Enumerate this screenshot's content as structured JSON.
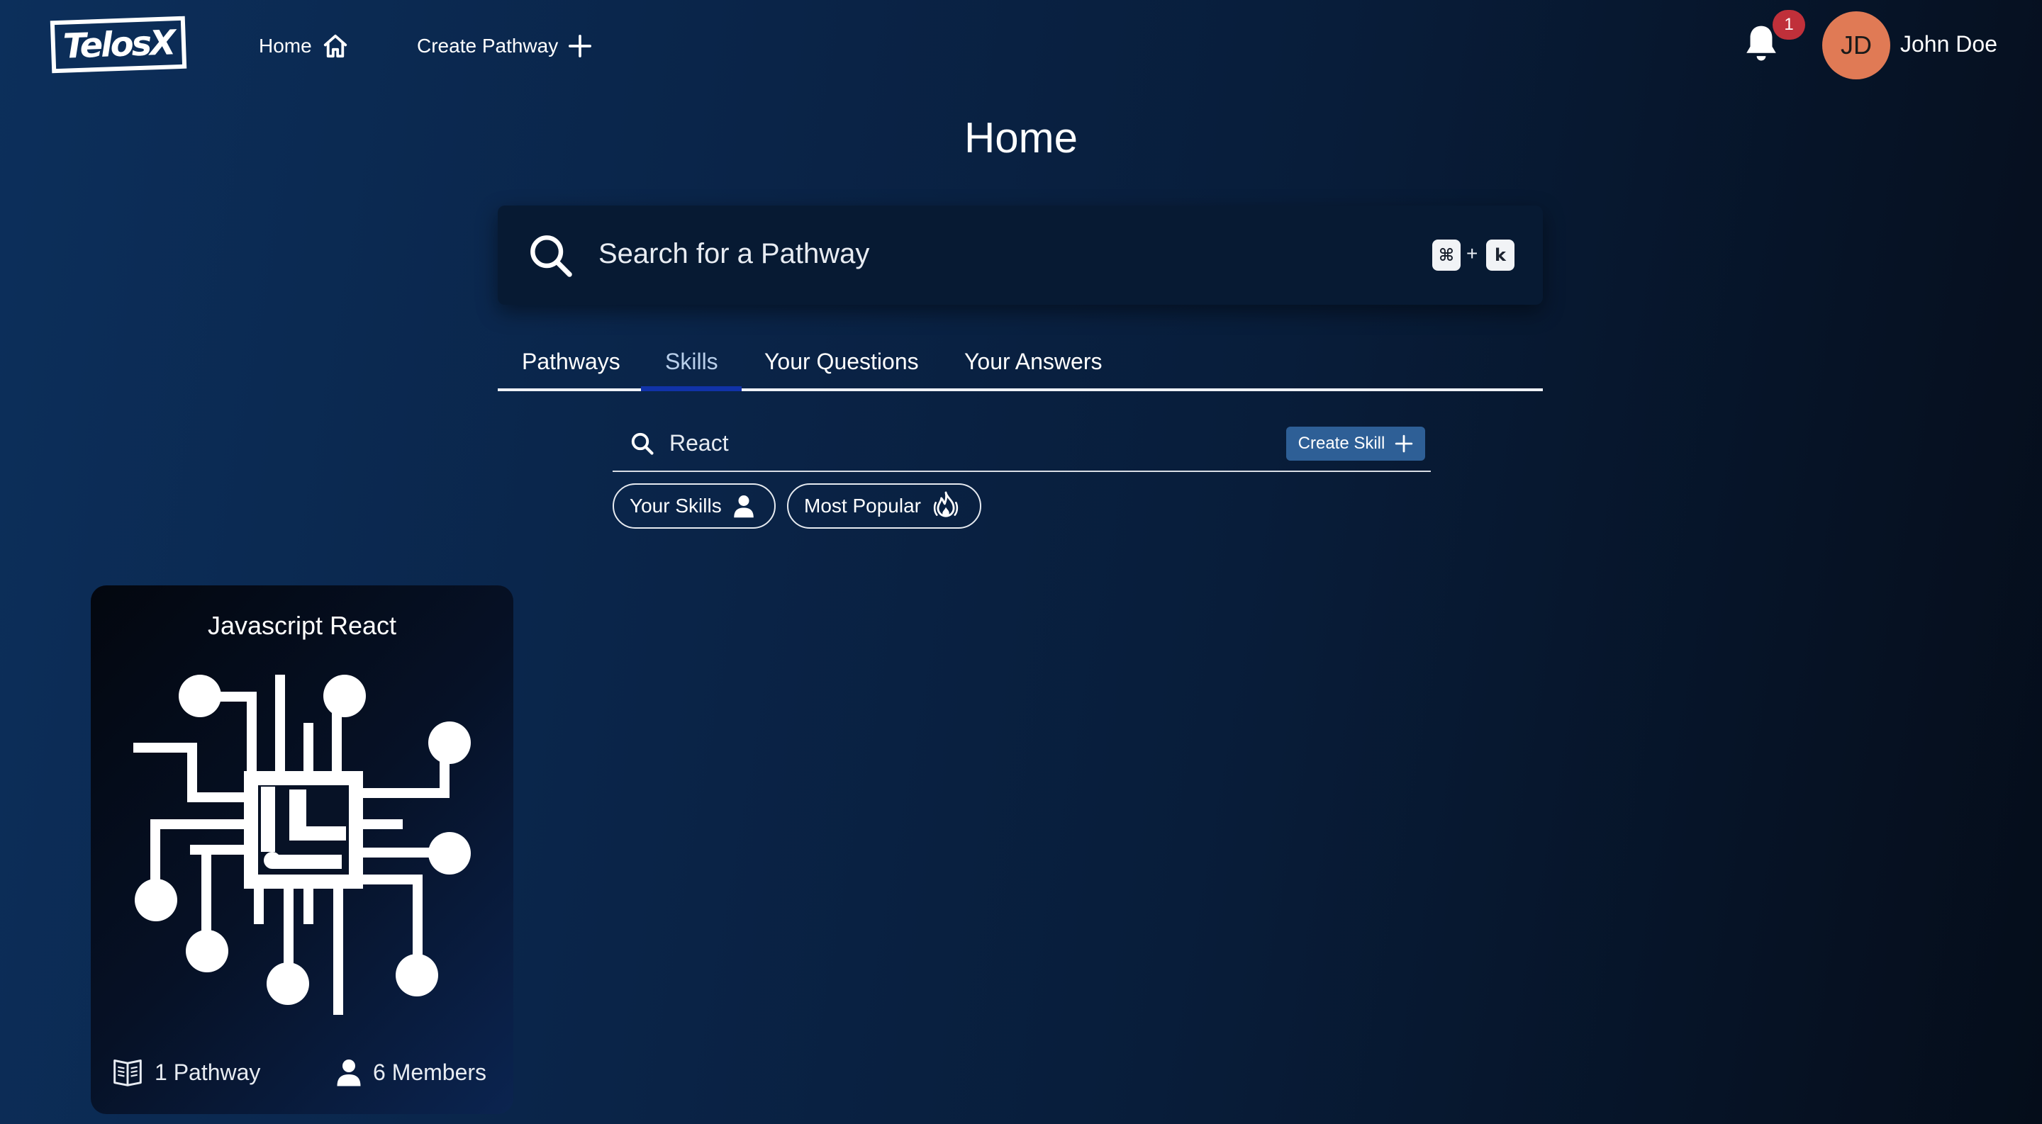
{
  "nav": {
    "logo_text": "TelosX",
    "home_label": "Home",
    "create_pathway_label": "Create Pathway",
    "notification_count": "1",
    "avatar_initials": "JD",
    "user_name": "John Doe"
  },
  "page": {
    "title": "Home"
  },
  "search": {
    "placeholder": "Search for a Pathway",
    "shortcut_cmd": "⌘",
    "shortcut_plus": "+",
    "shortcut_key": "k"
  },
  "tabs": [
    {
      "label": "Pathways",
      "active": false
    },
    {
      "label": "Skills",
      "active": true
    },
    {
      "label": "Your Questions",
      "active": false
    },
    {
      "label": "Your Answers",
      "active": false
    }
  ],
  "skills": {
    "search_value": "React",
    "create_label": "Create Skill",
    "filters": [
      {
        "label": "Your Skills",
        "icon": "user-icon"
      },
      {
        "label": "Most Popular",
        "icon": "fire-icon"
      }
    ]
  },
  "cards": [
    {
      "title": "Javascript React",
      "icon": "circuit-chip-icon",
      "pathways": "1 Pathway",
      "members": "6 Members"
    }
  ],
  "colors": {
    "accent_button": "#2e5f96",
    "tab_underline": "#1133a8",
    "badge": "#c0303a",
    "avatar": "#e07a55"
  }
}
